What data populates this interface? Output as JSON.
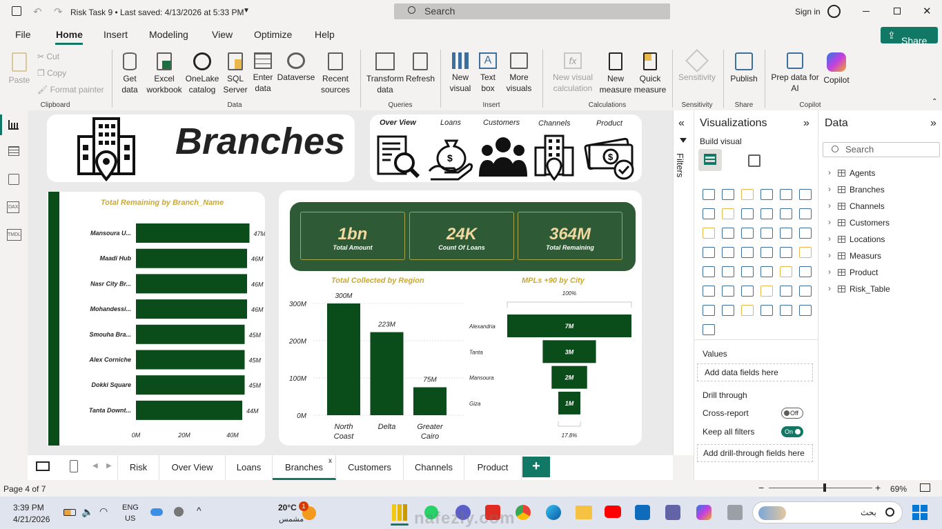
{
  "titlebar": {
    "title": "Risk Task 9 • Last saved: 4/13/2026 at 5:33 PM",
    "search": "Search",
    "sign_in": "Sign in"
  },
  "menu": {
    "items": [
      "File",
      "Home",
      "Insert",
      "Modeling",
      "View",
      "Optimize",
      "Help"
    ],
    "share": "Share"
  },
  "ribbon": {
    "clipboard": {
      "paste": "Paste",
      "cut": "Cut",
      "copy": "Copy",
      "format_painter": "Format painter",
      "group": "Clipboard"
    },
    "data": {
      "get_data": "Get data",
      "excel": "Excel workbook",
      "onelake": "OneLake catalog",
      "sql": "SQL Server",
      "enter_data": "Enter data",
      "dataverse": "Dataverse",
      "recent": "Recent sources",
      "group": "Data"
    },
    "queries": {
      "transform": "Transform data",
      "refresh": "Refresh",
      "group": "Queries"
    },
    "insert": {
      "new_visual": "New visual",
      "text_box": "Text box",
      "more_visuals": "More visuals",
      "group": "Insert"
    },
    "calculations": {
      "new_visual_calc": "New visual calculation",
      "new_measure": "New measure",
      "quick_measure": "Quick measure",
      "group": "Calculations"
    },
    "sensitivity": {
      "label": "Sensitivity",
      "group": "Sensitivity"
    },
    "share": {
      "publish": "Publish",
      "group": "Share"
    },
    "copilot": {
      "prep": "Prep data for AI",
      "copilot": "Copilot",
      "group": "Copilot"
    }
  },
  "report": {
    "title": "Branches",
    "nav": [
      "Over View",
      "Loans",
      "Customers",
      "Channels",
      "Product"
    ],
    "kpis": [
      {
        "value": "1bn",
        "label": "Total Amount"
      },
      {
        "value": "24K",
        "label": "Count Of Loans"
      },
      {
        "value": "364M",
        "label": "Total Remaining"
      }
    ]
  },
  "chart_data": [
    {
      "type": "bar",
      "title": "Total Remaining by Branch_Name",
      "orientation": "horizontal",
      "categories": [
        "Mansoura U...",
        "Maadi Hub",
        "Nasr City Br...",
        "Mohandessi...",
        "Smouha Bra...",
        "Alex Corniche",
        "Dokki Square",
        "Tanta Downt..."
      ],
      "values": [
        47,
        46,
        46,
        46,
        45,
        45,
        45,
        44
      ],
      "data_labels": [
        "47M",
        "46M",
        "46M",
        "46M",
        "45M",
        "45M",
        "45M",
        "44M"
      ],
      "xticks": [
        "0M",
        "20M",
        "40M"
      ],
      "xlim": [
        0,
        50
      ],
      "unit": "M",
      "color": "#0b4d1a"
    },
    {
      "type": "bar",
      "title": "Total Collected by Region",
      "categories": [
        "North Coast",
        "Delta",
        "Greater Cairo"
      ],
      "values": [
        300,
        223,
        75
      ],
      "data_labels": [
        "300M",
        "223M",
        "75M"
      ],
      "yticks": [
        "300M",
        "200M",
        "100M",
        "0M"
      ],
      "ylim": [
        0,
        300
      ],
      "unit": "M",
      "color": "#0b4d1a"
    },
    {
      "type": "funnel",
      "title": "MPLs +90 by City",
      "categories": [
        "Alexandria",
        "Tanta",
        "Mansoura",
        "Giza"
      ],
      "values": [
        7,
        3,
        2,
        1
      ],
      "data_labels": [
        "7M",
        "3M",
        "2M",
        "1M"
      ],
      "top_label": "100%",
      "bottom_label": "17.8%",
      "color": "#0b4d1a"
    }
  ],
  "filters": {
    "label": "Filters"
  },
  "visualizations": {
    "title": "Visualizations",
    "build_visual": "Build visual",
    "values": "Values",
    "add_data": "Add data fields here",
    "drill": "Drill through",
    "cross_report": "Cross-report",
    "cross_state": "Off",
    "keep_filters": "Keep all filters",
    "keep_state": "On",
    "add_drill": "Add drill-through fields here"
  },
  "data_pane": {
    "title": "Data",
    "search": "Search",
    "tables": [
      "Agents",
      "Branches",
      "Channels",
      "Customers",
      "Locations",
      "Measurs",
      "Product",
      "Risk_Table"
    ]
  },
  "tabs": [
    "Risk",
    "Over View",
    "Loans",
    "Branches",
    "Customers",
    "Channels",
    "Product"
  ],
  "status": {
    "page": "Page 4 of 7",
    "zoom": "69%"
  },
  "taskbar": {
    "time": "3:39 PM",
    "date": "4/21/2026",
    "lang1": "ENG",
    "lang2": "US",
    "temp": "20°C",
    "weather": "مشمس",
    "search": "بحث",
    "badge": "1"
  },
  "watermark": "nafezly.com",
  "colors": {
    "accent": "#0b4d1a",
    "gold": "#c7a934",
    "kpi_value": "#f0d8a0",
    "share_btn": "#117865"
  }
}
